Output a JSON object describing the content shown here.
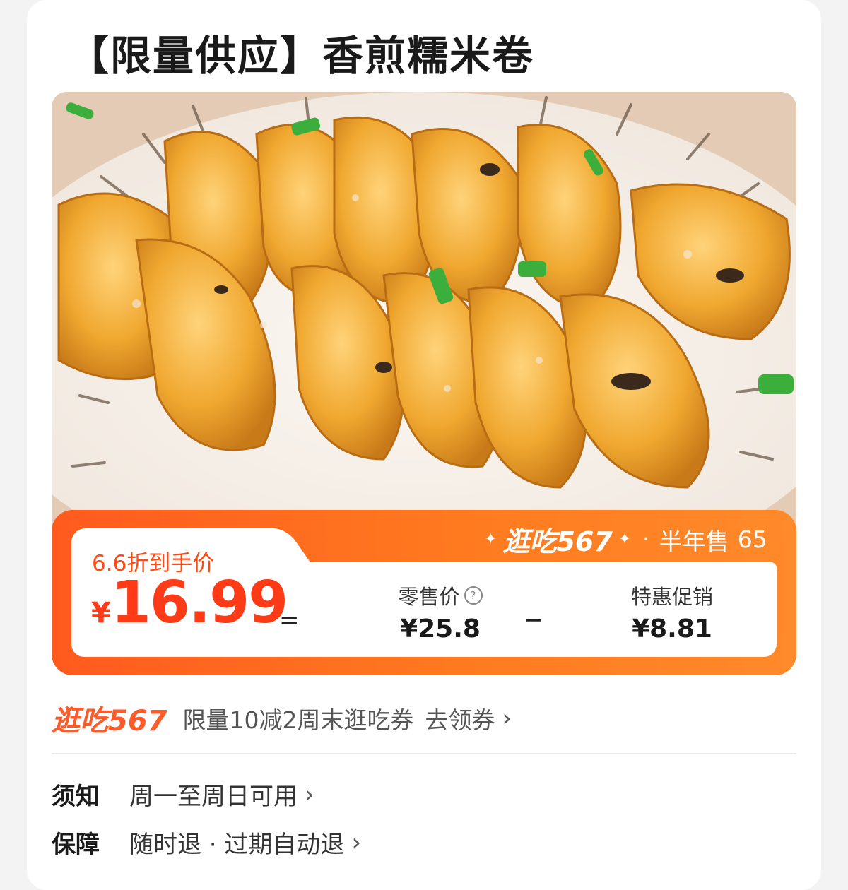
{
  "product": {
    "title": "【限量供应】香煎糯米卷"
  },
  "hero_image": {
    "alt": "Pan-fried glutinous rice rolls on a striped white plate",
    "icon": "food-photo"
  },
  "price_banner": {
    "discount_label": "6.6折到手价",
    "brand_name": "逛吃567",
    "sales_label": "半年售",
    "sales_count": "65",
    "final_currency": "¥",
    "final_price": "16.99",
    "equals": "=",
    "retail_label": "零售价",
    "retail_value": "¥25.8",
    "minus": "−",
    "promo_label": "特惠促销",
    "promo_value": "¥8.81"
  },
  "coupon": {
    "brand": "逛吃567",
    "text": "限量10减2周末逛吃券",
    "action": "去领券"
  },
  "info": {
    "notice_key": "须知",
    "notice_value": "周一至周日可用",
    "guarantee_key": "保障",
    "guarantee_value": "随时退 · 过期自动退"
  },
  "colors": {
    "accent": "#ff4a14",
    "banner_start": "#ff5a1e",
    "banner_end": "#ff8a2a",
    "text_dark": "#1a1a1a"
  }
}
